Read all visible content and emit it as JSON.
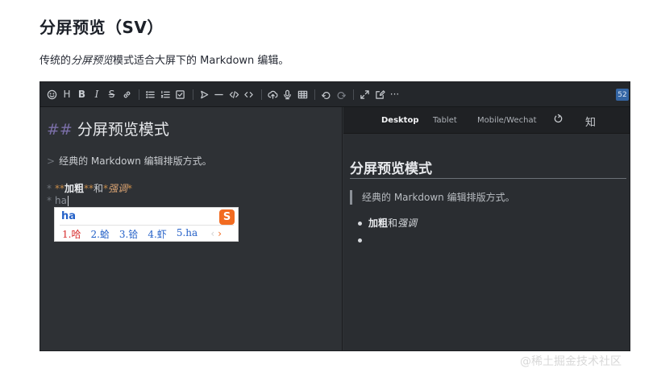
{
  "article": {
    "title": "分屏预览（SV）",
    "text_before": "传统的",
    "text_em": "分屏预览",
    "text_after": "模式适合大屏下的 Markdown 编辑。"
  },
  "toolbar": {
    "heading_label": "H",
    "bold_label": "B",
    "italic_label": "I",
    "strike_label": "S",
    "more_label": "···",
    "word_count": "52"
  },
  "editor": {
    "h2_marker": "##",
    "h2_text": "分屏预览模式",
    "quote_marker": ">",
    "quote_text": "经典的 Markdown 编辑排版方式。",
    "li_marker": "*",
    "bold_open": "**",
    "bold_text": "加粗",
    "bold_close": "**",
    "and_text": "和",
    "italic_open": "*",
    "italic_text": "强调",
    "italic_close": "*",
    "typed_text": "ha"
  },
  "ime": {
    "input": "ha",
    "logo": "S",
    "candidates": [
      "1.哈",
      "2.蛤",
      "3.铪",
      "4.虾",
      "5.ha"
    ],
    "prev": "‹",
    "next": "›"
  },
  "preview": {
    "tabs": [
      "Desktop",
      "Tablet",
      "Mobile/Wechat"
    ],
    "zhihu_label": "知",
    "h2": "分屏预览模式",
    "quote": "经典的 Markdown 编辑排版方式。",
    "li_bold": "加粗",
    "li_and": "和",
    "li_italic": "强调"
  },
  "watermark": "@稀土掘金技术社区"
}
